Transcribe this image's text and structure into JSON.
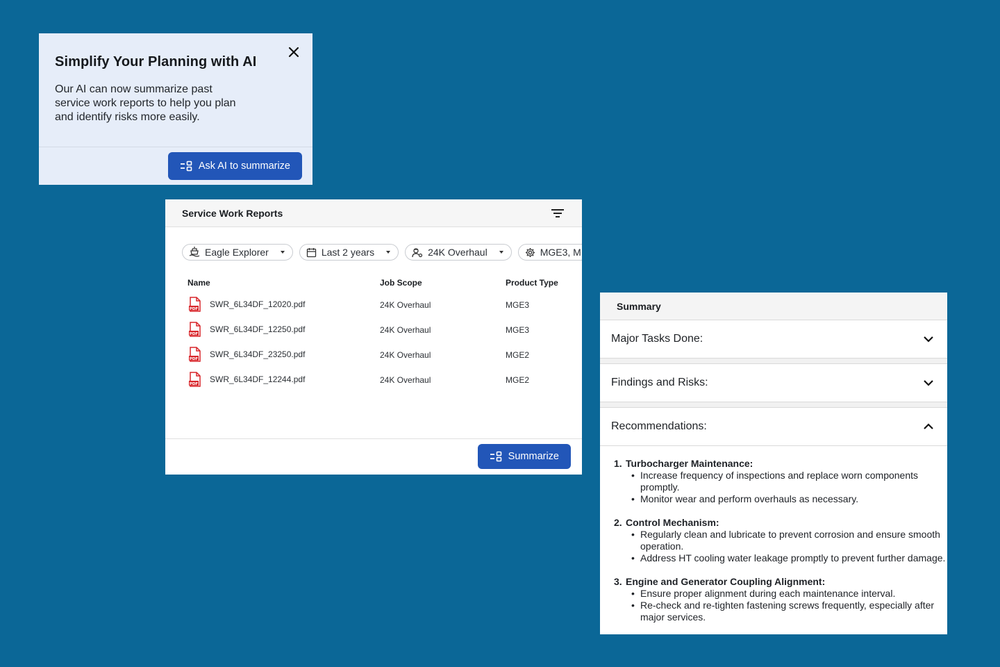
{
  "promo": {
    "title": "Simplify Your Planning with AI",
    "body": "Our AI can now summarize past service work reports to help you plan and identify risks more easily.",
    "cta_label": "Ask AI to summarize",
    "close_icon": "close-icon"
  },
  "reports": {
    "title": "Service Work Reports",
    "filters": [
      {
        "label": "Eagle Explorer",
        "icon": "ship-icon"
      },
      {
        "label": "Last 2 years",
        "icon": "calendar-icon"
      },
      {
        "label": "24K Overhaul",
        "icon": "worker-icon"
      },
      {
        "label": "MGE3, M",
        "icon": "gear-icon"
      }
    ],
    "columns": {
      "name": "Name",
      "scope": "Job Scope",
      "type": "Product Type"
    },
    "rows": [
      {
        "name": "SWR_6L34DF_12020.pdf",
        "scope": "24K Overhaul",
        "type": "MGE3"
      },
      {
        "name": "SWR_6L34DF_12250.pdf",
        "scope": "24K Overhaul",
        "type": "MGE3"
      },
      {
        "name": "SWR_6L34DF_23250.pdf",
        "scope": "24K Overhaul",
        "type": "MGE2"
      },
      {
        "name": "SWR_6L34DF_12244.pdf",
        "scope": "24K Overhaul",
        "type": "MGE2"
      }
    ],
    "summarize_label": "Summarize"
  },
  "summary": {
    "title": "Summary",
    "sections": [
      {
        "label": "Major Tasks Done:",
        "expanded": false
      },
      {
        "label": "Findings and Risks:",
        "expanded": false
      },
      {
        "label": "Recommendations:",
        "expanded": true
      }
    ],
    "recommendations": [
      {
        "num": "1.",
        "title": "Turbocharger Maintenance:",
        "items": [
          "Increase frequency of inspections and replace worn components promptly.",
          "Monitor wear and perform overhauls as necessary."
        ]
      },
      {
        "num": "2.",
        "title": "Control Mechanism:",
        "items": [
          "Regularly clean and lubricate to prevent corrosion and ensure smooth operation.",
          "Address HT cooling water leakage promptly to prevent further damage."
        ]
      },
      {
        "num": "3.",
        "title": "Engine and Generator Coupling Alignment:",
        "items": [
          "Ensure proper alignment during each maintenance interval.",
          "Re-check and re-tighten fastening screws frequently, especially after major services."
        ]
      }
    ]
  },
  "colors": {
    "background": "#0b6797",
    "primary_button": "#2256b8",
    "promo_bg": "#e6edf9",
    "pdf_red": "#d8262b"
  }
}
